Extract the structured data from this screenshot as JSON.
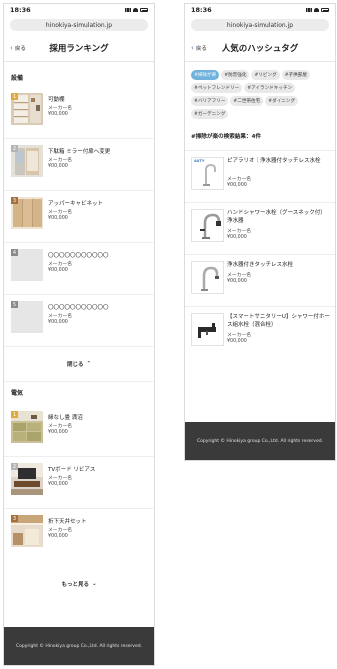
{
  "status": {
    "time": "18:36"
  },
  "url": "hinokiya-simulation.jp",
  "back_label": "戻る",
  "ranking": {
    "title": "採用ランキング",
    "facilities": {
      "heading": "設備",
      "items": [
        {
          "rank": "1",
          "name": "可動棚",
          "maker": "メーカー名",
          "price": "¥00,000",
          "badge_color": "#e1a93b"
        },
        {
          "rank": "2",
          "name": "下駄箱 ミラー付扉へ変更",
          "maker": "メーカー名",
          "price": "¥00,000",
          "badge_color": "#b4b4b4"
        },
        {
          "rank": "3",
          "name": "アッパーキャビネット",
          "maker": "メーカー名",
          "price": "¥00,000",
          "badge_color": "#a66f3c"
        },
        {
          "rank": "4",
          "name": "〇〇〇〇〇〇〇〇〇〇〇",
          "maker": "メーカー名",
          "price": "¥00,000",
          "badge_color": "#8a8a8a"
        },
        {
          "rank": "5",
          "name": "〇〇〇〇〇〇〇〇〇〇〇",
          "maker": "メーカー名",
          "price": "¥00,000",
          "badge_color": "#8a8a8a"
        }
      ],
      "toggle_label": "閉じる"
    },
    "electric": {
      "heading": "電気",
      "items": [
        {
          "rank": "1",
          "name": "縁なし畳 満沼",
          "maker": "メーカー名",
          "price": "¥00,000",
          "badge_color": "#e1a93b"
        },
        {
          "rank": "2",
          "name": "TVボード リビアス",
          "maker": "メーカー名",
          "price": "¥00,000",
          "badge_color": "#b4b4b4"
        },
        {
          "rank": "3",
          "name": "折下天井セット",
          "maker": "メーカー名",
          "price": "¥00,000",
          "badge_color": "#a66f3c"
        }
      ],
      "toggle_label": "もっと見る"
    },
    "footer": "Copyright © Hinokiya group Co.,Ltd. All rights reserved."
  },
  "hashtags": {
    "title": "人気のハッシュタグ",
    "tags": [
      {
        "label": "#掃除が楽",
        "active": true
      },
      {
        "label": "#防音強化",
        "active": false
      },
      {
        "label": "#リビング",
        "active": false
      },
      {
        "label": "#子供部屋",
        "active": false
      },
      {
        "label": "#ペットフレンドリー",
        "active": false
      },
      {
        "label": "#アイランドキッチン",
        "active": false
      },
      {
        "label": "#バリアフリー",
        "active": false
      },
      {
        "label": "#二世帯住宅",
        "active": false
      },
      {
        "label": "#ダイニング",
        "active": false
      },
      {
        "label": "#ガーデニング",
        "active": false
      }
    ],
    "results_heading": "#掃除が楽の検索結果：4件",
    "results": [
      {
        "name": "ピアラリオ｜浄水器付タッチレス水栓",
        "maker": "メーカー名",
        "price": "¥00,000",
        "logo": "AUTY"
      },
      {
        "name": "ハンドシャワー水栓（グースネック付）浄水器",
        "maker": "メーカー名",
        "price": "¥00,000",
        "logo": ""
      },
      {
        "name": "浄水器付きタッチレス水栓",
        "maker": "メーカー名",
        "price": "¥00,000",
        "logo": ""
      },
      {
        "name": "【スマートサニタリーU】シャワー付ホース組水栓（混合栓）",
        "maker": "メーカー名",
        "price": "¥00,000",
        "logo": ""
      }
    ],
    "footer": "Copyright © Hinokiya group Co.,Ltd. All rights reserved."
  }
}
